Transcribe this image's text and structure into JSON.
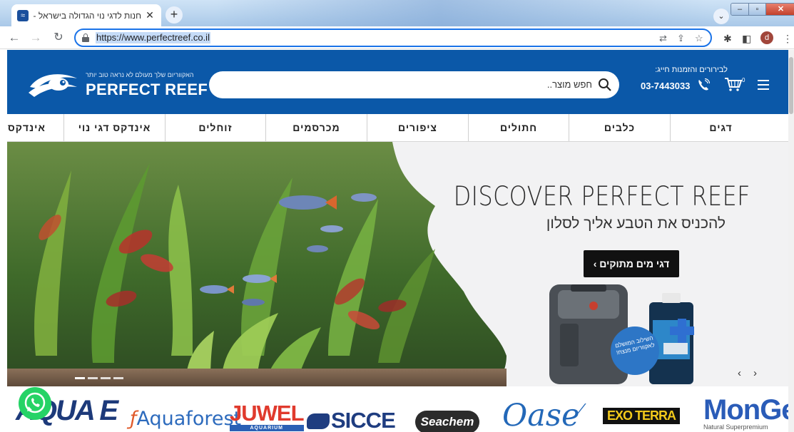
{
  "browser": {
    "tab_title": "חנות לדגי נוי הגדולה בישראל - P",
    "tab_favicon": "perfect-reef-favicon",
    "new_tab_label": "+",
    "url": "https://www.perfectreef.co.il",
    "profile_initial": "d"
  },
  "header": {
    "logo_tagline": "האקווריום שלך מעולם לא נראה טוב יותר",
    "logo_name": "PERFECT REEF",
    "search_placeholder": "חפש מוצר..",
    "phone_label": "לבירורים והזמנות חייג:",
    "phone_number": "03-7443033",
    "cart_count": "0"
  },
  "nav": {
    "items": [
      "דגים",
      "כלבים",
      "חתולים",
      "ציפורים",
      "מכרסמים",
      "זוחלים",
      "אינדקס דגי נוי",
      "אינדקס"
    ]
  },
  "hero": {
    "title": "DISCOVER PERFECT REEF",
    "subtitle": "להכניס את הטבע אליך לסלון",
    "cta_label": "דגי מים מתוקים ›",
    "badge_text": "השילוב המושלם לאקווריום מנצח!",
    "prev_label": "‹",
    "next_label": "›"
  },
  "brands": {
    "aqua": "AQUA E",
    "aquaforest": "Aquaforest",
    "juwel": "JUWEL",
    "juwel_sub": "AQUARIUM",
    "sicce": "SICCE",
    "seachem": "Seachem",
    "oase": "Oase",
    "exoterra": "EXO TERRA",
    "monge": "MonGe",
    "monge_sub": "Natural Superpremium"
  },
  "colors": {
    "header_blue": "#0b58a8",
    "whatsapp_green": "#25d366",
    "cta_black": "#111111"
  }
}
